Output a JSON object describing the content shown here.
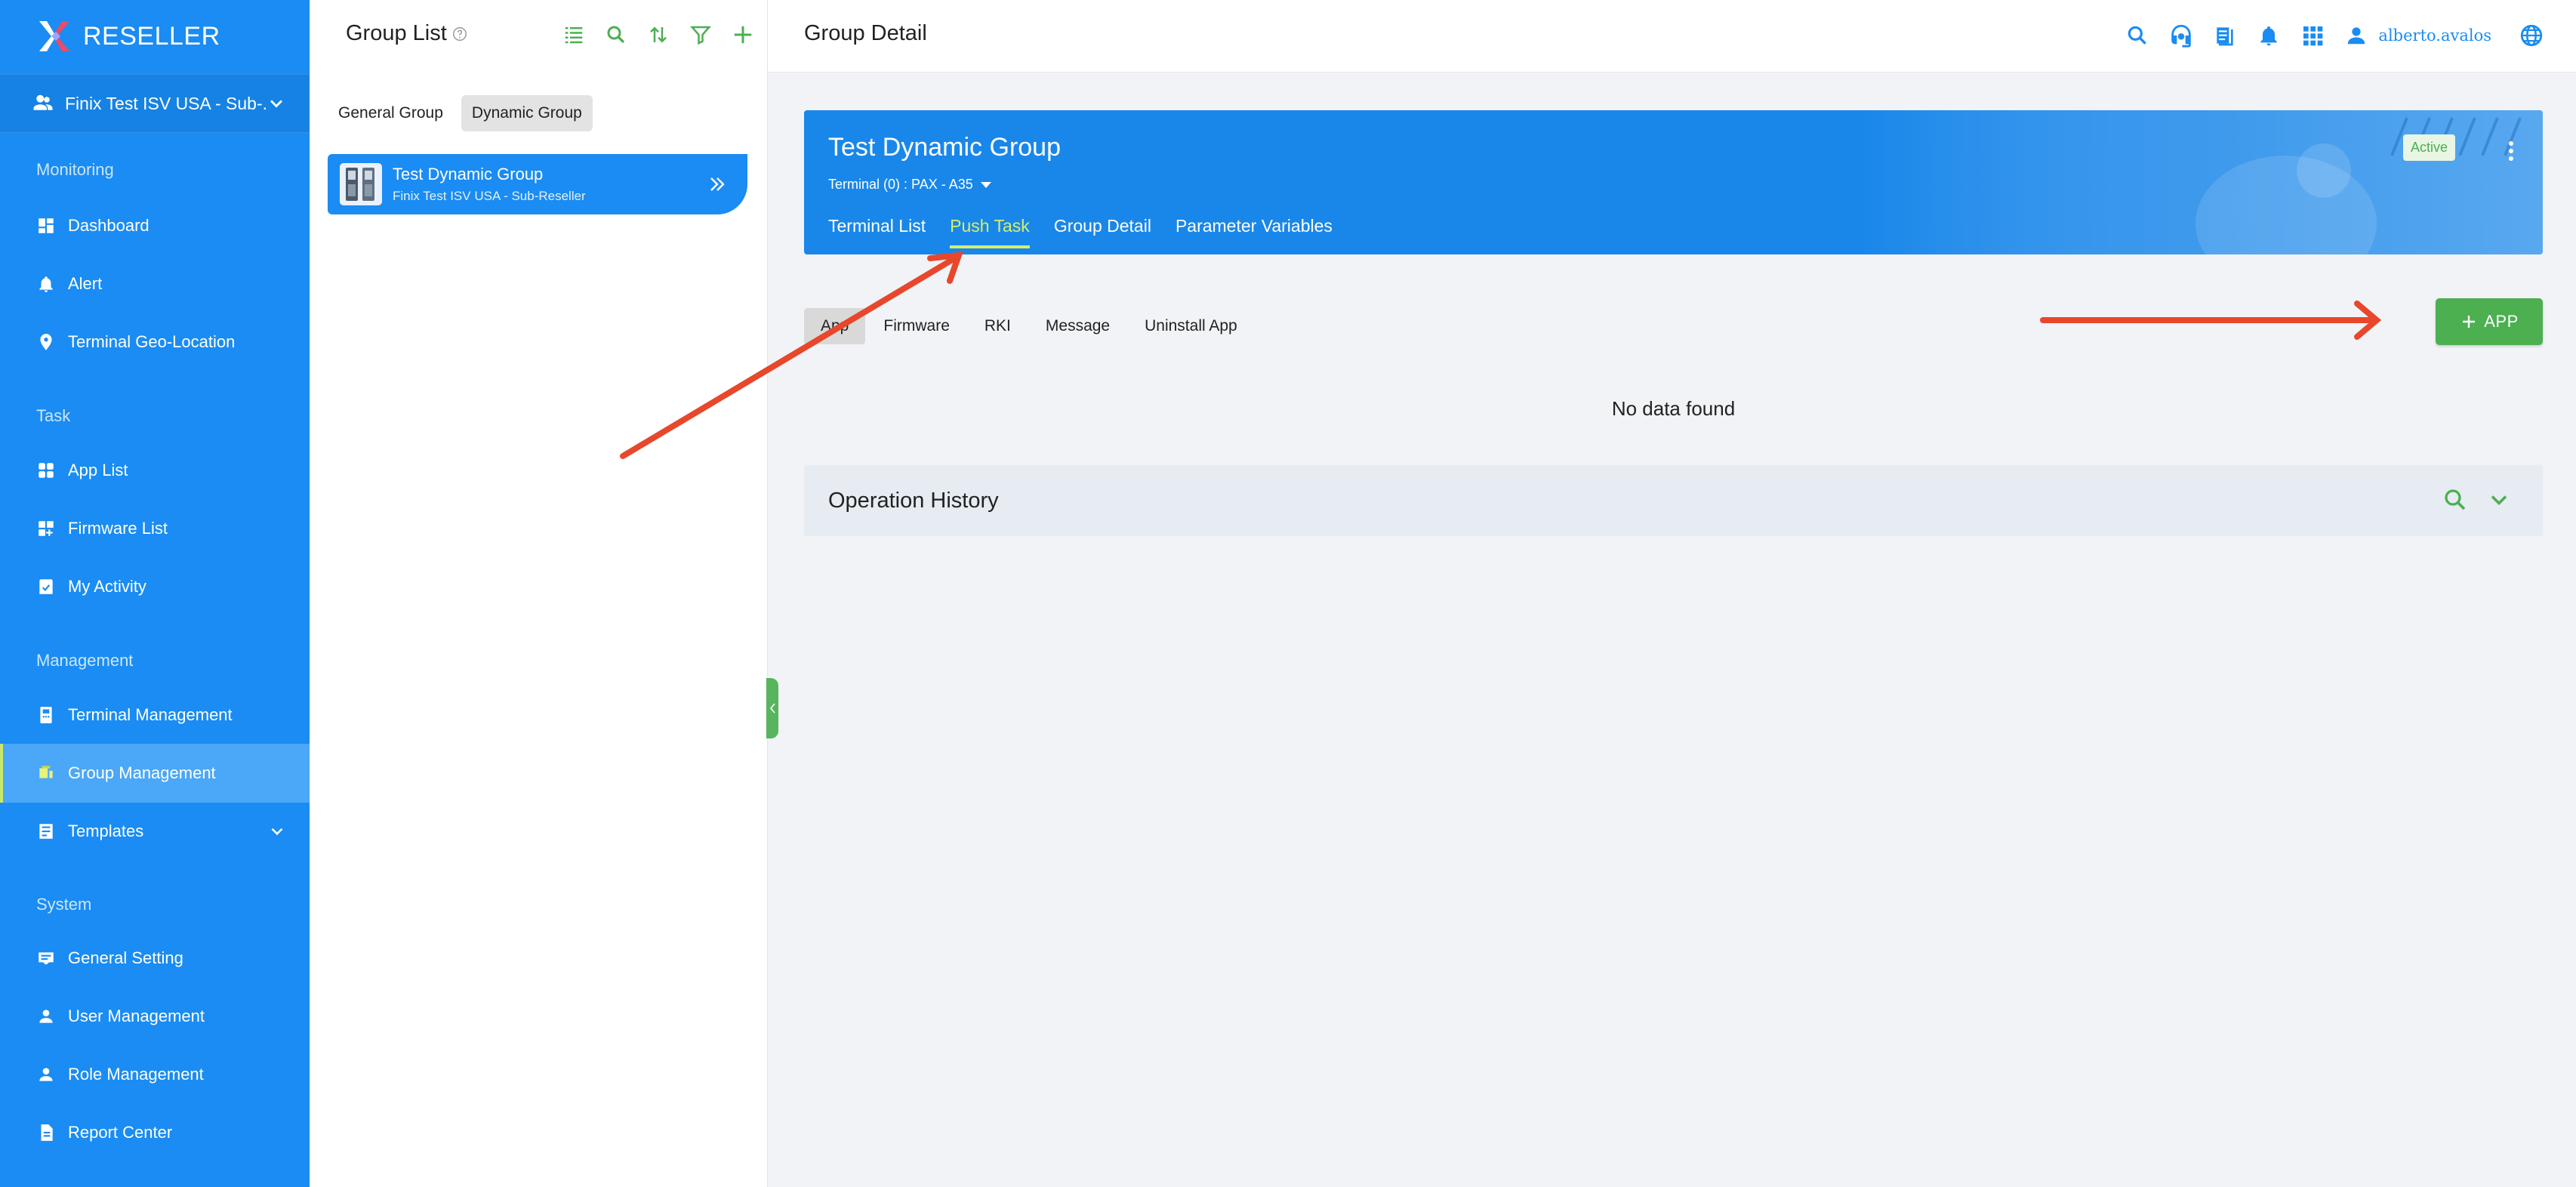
{
  "brand": {
    "name": "RESELLER"
  },
  "org_selector": {
    "label": "Finix Test ISV USA - Sub-..."
  },
  "sidebar": {
    "sections": [
      {
        "title": "Monitoring",
        "items": [
          {
            "label": "Dashboard",
            "icon": "dashboard-icon"
          },
          {
            "label": "Alert",
            "icon": "alert-icon"
          },
          {
            "label": "Terminal Geo-Location",
            "icon": "location-pin-icon"
          }
        ]
      },
      {
        "title": "Task",
        "items": [
          {
            "label": "App List",
            "icon": "apps-icon"
          },
          {
            "label": "Firmware List",
            "icon": "firmware-icon"
          },
          {
            "label": "My Activity",
            "icon": "activity-icon"
          }
        ]
      },
      {
        "title": "Management",
        "items": [
          {
            "label": "Terminal Management",
            "icon": "terminal-icon"
          },
          {
            "label": "Group Management",
            "icon": "group-icon",
            "active": true
          },
          {
            "label": "Templates",
            "icon": "templates-icon"
          }
        ]
      },
      {
        "title": "System",
        "items": [
          {
            "label": "General Setting",
            "icon": "settings-icon"
          },
          {
            "label": "User Management",
            "icon": "user-icon"
          },
          {
            "label": "Role Management",
            "icon": "role-icon"
          },
          {
            "label": "Report Center",
            "icon": "report-icon"
          }
        ]
      }
    ]
  },
  "group_list": {
    "title": "Group List",
    "tabs": [
      {
        "label": "General Group"
      },
      {
        "label": "Dynamic Group",
        "selected": true
      }
    ],
    "items": [
      {
        "name": "Test Dynamic Group",
        "owner": "Finix Test ISV USA - Sub-Reseller"
      }
    ]
  },
  "header": {
    "title": "Group Detail",
    "username": "alberto.avalos"
  },
  "group_detail": {
    "name": "Test Dynamic Group",
    "terminal_info": "Terminal (0) : PAX  -  A35",
    "status": "Active",
    "tabs": [
      {
        "label": "Terminal List"
      },
      {
        "label": "Push Task",
        "selected": true
      },
      {
        "label": "Group Detail"
      },
      {
        "label": "Parameter Variables"
      }
    ]
  },
  "push_task": {
    "tabs": [
      {
        "label": "App",
        "selected": true
      },
      {
        "label": "Firmware"
      },
      {
        "label": "RKI"
      },
      {
        "label": "Message"
      },
      {
        "label": "Uninstall App"
      }
    ],
    "add_button": "APP",
    "empty_message": "No data found"
  },
  "operation_history": {
    "title": "Operation History"
  },
  "colors": {
    "sidebar": "#1a8cf3",
    "accent_green": "#4caf50",
    "tab_highlight": "#d6ee6c",
    "annotation": "#e8472b"
  }
}
